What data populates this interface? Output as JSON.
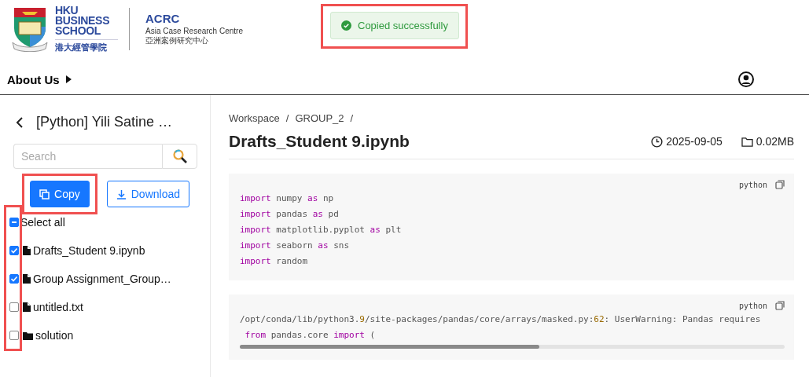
{
  "header": {
    "school_name": "HKU BUSINESS SCHOOL",
    "school_name_zh": "港大經管學院",
    "centre_abbr": "ACRC",
    "centre_name": "Asia Case Research Centre",
    "centre_name_zh": "亞洲案例研究中心"
  },
  "toast": {
    "text": "Copied successfully",
    "highlighted": true
  },
  "nav": {
    "items": [
      {
        "label": "About Us"
      }
    ]
  },
  "sidebar": {
    "title": "[Python] Yili Satine …",
    "search": {
      "placeholder": "Search"
    },
    "buttons": [
      {
        "kind": "copy",
        "label": "Copy",
        "highlighted": true
      },
      {
        "kind": "download",
        "label": "Download",
        "highlighted": false
      }
    ],
    "checkboxes_highlighted": true,
    "select_all": {
      "label": "Select all",
      "indeterminate": true
    },
    "files": [
      {
        "name": "Drafts_Student 9.ipynb",
        "kind": "file",
        "checked": true
      },
      {
        "name": "Group Assignment_Group…",
        "kind": "file",
        "checked": true
      },
      {
        "name": "untitled.txt",
        "kind": "file",
        "checked": false
      },
      {
        "name": "solution",
        "kind": "folder",
        "checked": false
      }
    ]
  },
  "main": {
    "breadcrumbs": [
      {
        "label": "Workspace",
        "separator": "/"
      },
      {
        "label": "GROUP_2",
        "separator": "/"
      }
    ],
    "title": "Drafts_Student 9.ipynb",
    "date": "2025-09-05",
    "size": "0.02MB",
    "code_blocks": [
      {
        "language": "python",
        "scrollbar": false,
        "lines": [
          [
            {
              "kind": "keyword",
              "text": "import"
            },
            {
              "kind": "plain",
              "text": " numpy "
            },
            {
              "kind": "keyword",
              "text": "as"
            },
            {
              "kind": "plain",
              "text": " np"
            }
          ],
          [
            {
              "kind": "keyword",
              "text": "import"
            },
            {
              "kind": "plain",
              "text": " pandas "
            },
            {
              "kind": "keyword",
              "text": "as"
            },
            {
              "kind": "plain",
              "text": " pd"
            }
          ],
          [
            {
              "kind": "keyword",
              "text": "import"
            },
            {
              "kind": "plain",
              "text": " matplotlib.pyplot "
            },
            {
              "kind": "keyword",
              "text": "as"
            },
            {
              "kind": "plain",
              "text": " plt"
            }
          ],
          [
            {
              "kind": "keyword",
              "text": "import"
            },
            {
              "kind": "plain",
              "text": " seaborn "
            },
            {
              "kind": "keyword",
              "text": "as"
            },
            {
              "kind": "plain",
              "text": " sns"
            }
          ],
          [
            {
              "kind": "keyword",
              "text": "import"
            },
            {
              "kind": "plain",
              "text": " random"
            }
          ]
        ]
      },
      {
        "language": "python",
        "scrollbar": true,
        "lines": [
          [
            {
              "kind": "plain",
              "text": "/opt/conda/lib/python3."
            },
            {
              "kind": "number",
              "text": "9"
            },
            {
              "kind": "plain",
              "text": "/site-packages/pandas/core/arrays/masked.py:"
            },
            {
              "kind": "number",
              "text": "62"
            },
            {
              "kind": "plain",
              "text": ": UserWarning: Pandas requires"
            }
          ],
          [
            {
              "kind": "keyword",
              "text": " from"
            },
            {
              "kind": "plain",
              "text": " pandas.core "
            },
            {
              "kind": "keyword",
              "text": "import"
            },
            {
              "kind": "plain",
              "text": " ("
            }
          ]
        ]
      }
    ]
  }
}
